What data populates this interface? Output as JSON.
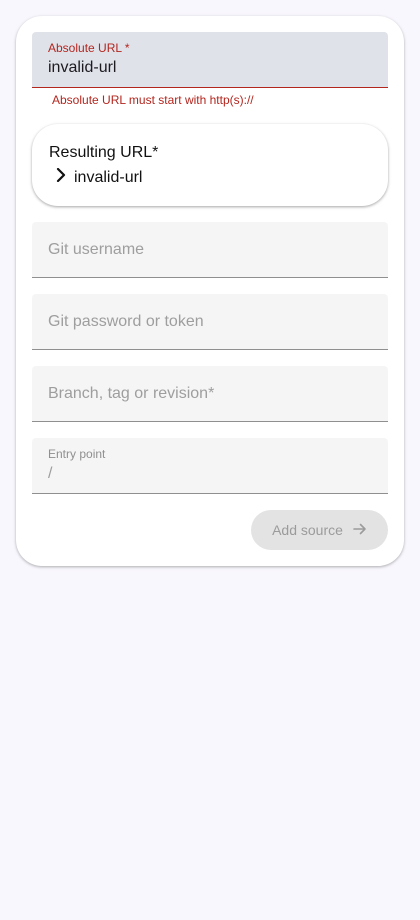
{
  "form": {
    "absolute_url": {
      "label": "Absolute URL *",
      "value": "invalid-url",
      "error": "Absolute URL must start with http(s)://"
    },
    "resulting_url": {
      "title": "Resulting URL*",
      "value": "invalid-url"
    },
    "git_username": {
      "placeholder": "Git username"
    },
    "git_password": {
      "placeholder": "Git password or token"
    },
    "branch": {
      "placeholder": "Branch, tag or revision*"
    },
    "entry_point": {
      "label": "Entry point",
      "value": "/"
    },
    "add_source_button": {
      "label": "Add source"
    }
  },
  "icons": {
    "chevron": "chevron-right-icon",
    "arrow": "arrow-right-icon"
  },
  "colors": {
    "error": "#b3261e",
    "background": "#f8f7fd",
    "field": "#f5f5f5",
    "error_field": "#e0e2ea"
  }
}
